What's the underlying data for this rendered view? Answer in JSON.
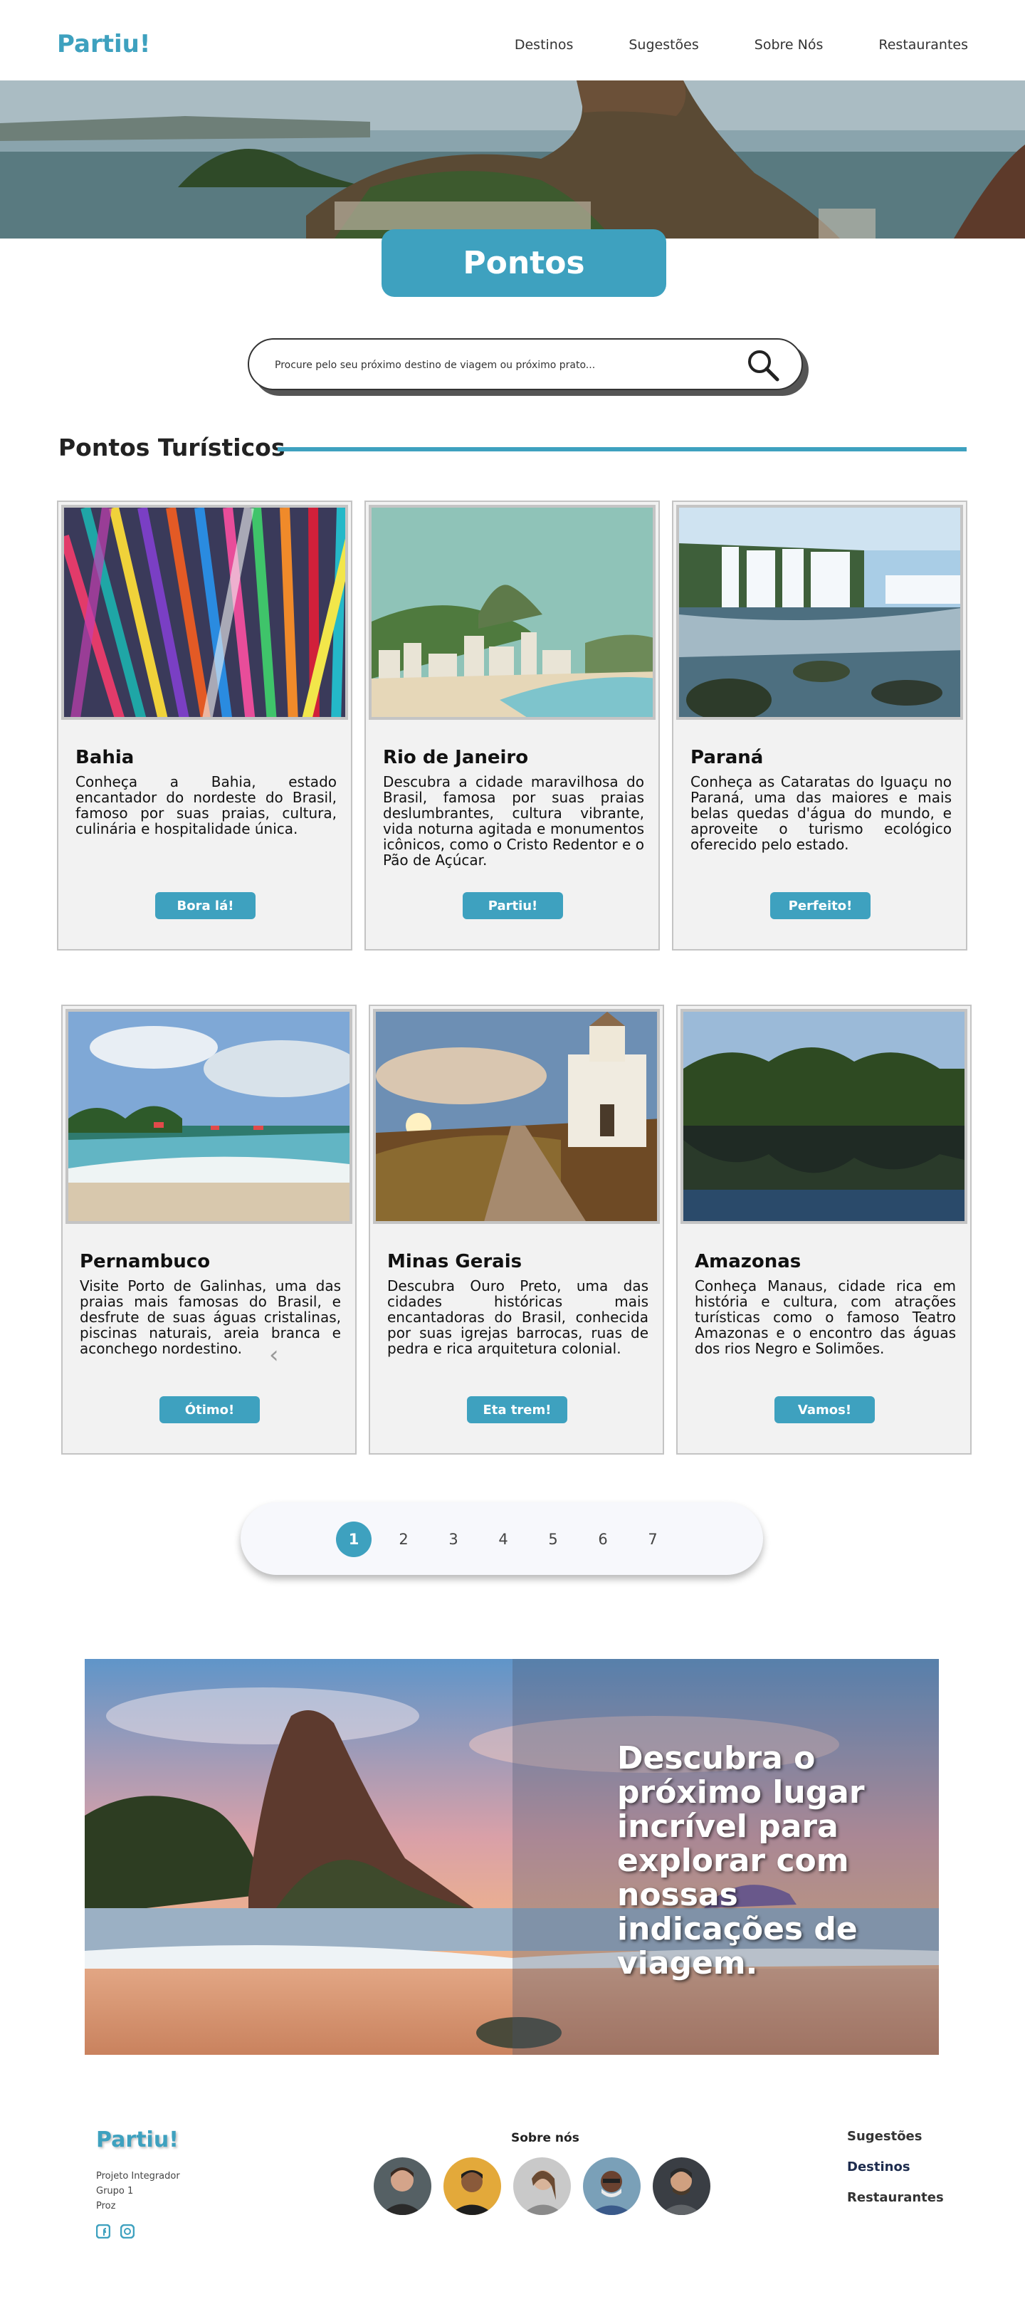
{
  "nav": {
    "logo": "Partiu!",
    "links": [
      "Destinos",
      "Sugestões",
      "Sobre Nós",
      "Restaurantes"
    ]
  },
  "hero": {
    "title": "Pontos Turísticos"
  },
  "search": {
    "placeholder": "Procure pelo seu próximo destino de viagem ou próximo prato..."
  },
  "section": {
    "title": "Pontos Turísticos"
  },
  "cards": [
    {
      "title": "Bahia",
      "text": "Conheça a Bahia, estado encantador do nordeste do Brasil, famoso por suas praias, cultura, culinária e hospitalidade única.",
      "button": "Bora lá!"
    },
    {
      "title": "Rio de Janeiro",
      "text": "Descubra a cidade maravilhosa do Brasil, famosa por suas praias deslumbrantes, cultura vibrante, vida noturna agitada e monumentos icônicos, como o Cristo Redentor e o Pão de Açúcar.",
      "button": "Partiu!"
    },
    {
      "title": "Paraná",
      "text": "Conheça as Cataratas do Iguaçu no Paraná, uma das maiores e mais belas quedas d'água do mundo, e aproveite o turismo ecológico oferecido pelo estado.",
      "button": "Perfeito!"
    },
    {
      "title": "Pernambuco",
      "text": "Visite Porto de Galinhas, uma das praias mais famosas do Brasil, e desfrute de suas águas cristalinas, piscinas naturais, areia branca e aconchego nordestino.",
      "button": "Ótimo!"
    },
    {
      "title": "Minas Gerais",
      "text": "Descubra Ouro Preto, uma das cidades históricas mais encantadoras do Brasil, conhecida por suas igrejas barrocas, ruas de pedra e rica arquitetura colonial.",
      "button": "Eta trem!"
    },
    {
      "title": "Amazonas",
      "text": "Conheça Manaus, cidade rica em história e cultura, com atrações turísticas como o famoso Teatro Amazonas e o encontro das águas dos rios Negro e Solimões.",
      "button": "Vamos!"
    }
  ],
  "pagination": {
    "pages": [
      "1",
      "2",
      "3",
      "4",
      "5",
      "6",
      "7"
    ],
    "active": "1"
  },
  "banner": {
    "text": "Descubra o próximo lugar incrível para explorar com nossas indicações de viagem."
  },
  "footer": {
    "logo": "Partiu!",
    "info": [
      "Projeto Integrador",
      "Grupo 1",
      "Proz"
    ],
    "about_title": "Sobre nós",
    "links": [
      "Sugestões",
      "Destinos",
      "Restaurantes"
    ]
  },
  "colors": {
    "accent": "#3ea1bf",
    "card_bg": "#f2f2f2",
    "card_border": "#c4c4c4"
  },
  "icons": [
    "search-icon",
    "chevron-left-icon",
    "facebook-icon",
    "instagram-icon"
  ]
}
